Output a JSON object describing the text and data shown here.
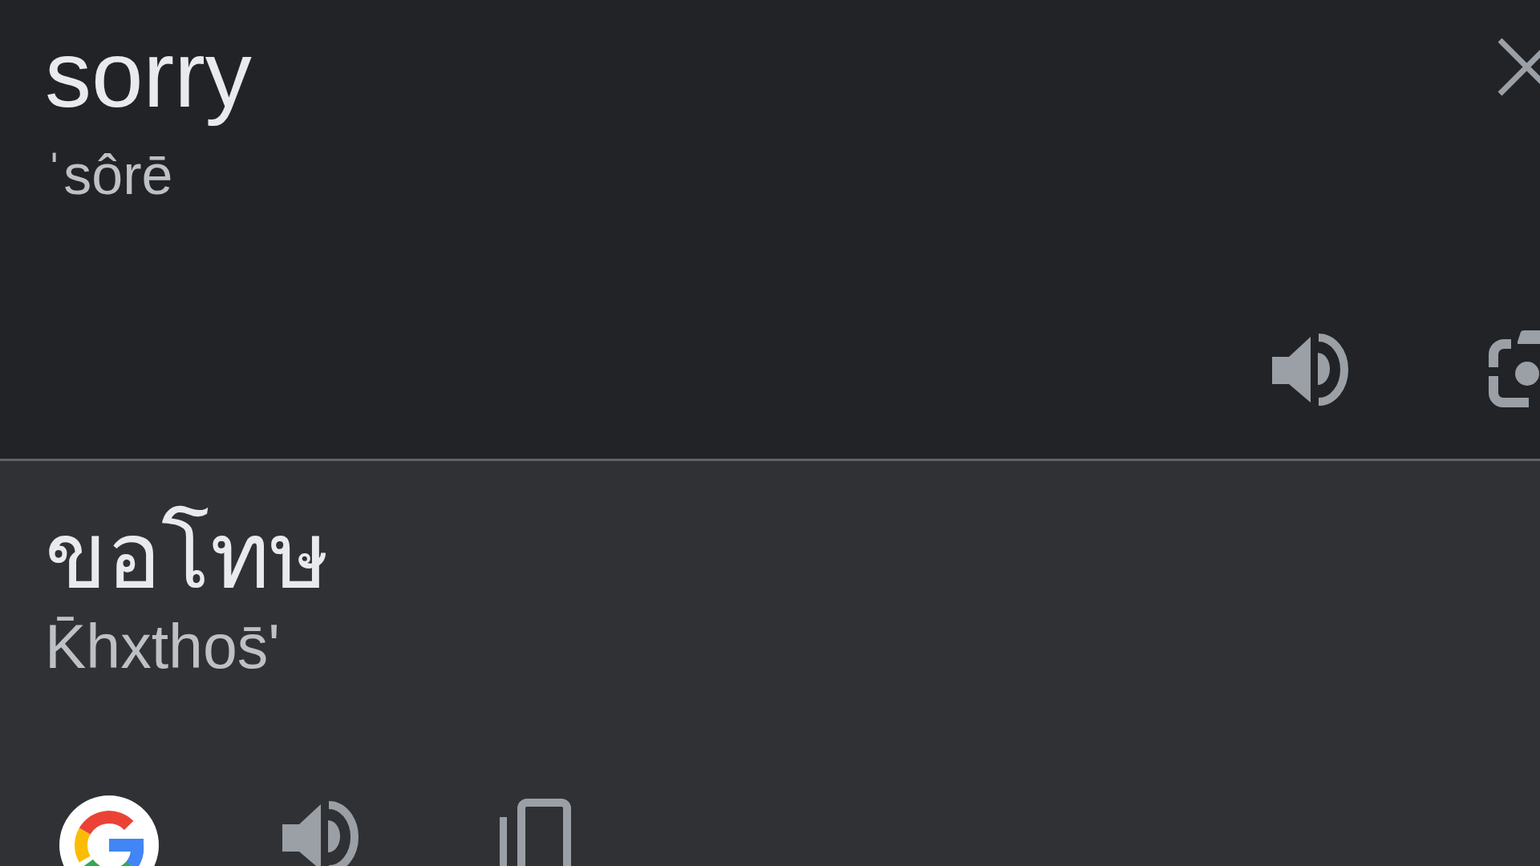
{
  "source": {
    "text": "sorry",
    "phonetic": "ˈsôrē"
  },
  "translation": {
    "text": "ขอโทษ",
    "romanization": "K̄hxthos̄ʹ"
  }
}
